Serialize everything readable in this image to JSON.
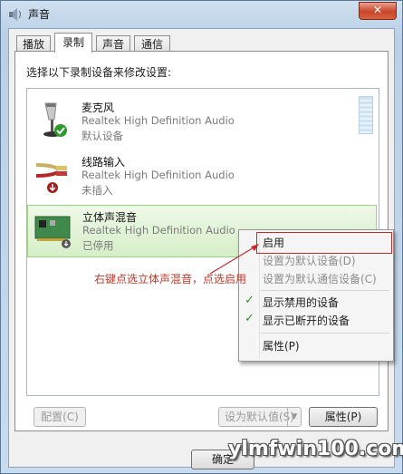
{
  "window": {
    "title": "声音",
    "close_label": "✕"
  },
  "tabs": [
    {
      "label": "播放",
      "active": false
    },
    {
      "label": "录制",
      "active": true
    },
    {
      "label": "声音",
      "active": false
    },
    {
      "label": "通信",
      "active": false
    }
  ],
  "instruction": "选择以下录制设备来修改设置:",
  "devices": [
    {
      "name": "麦克风",
      "driver": "Realtek High Definition Audio",
      "status": "默认设备",
      "icon": "microphone-icon"
    },
    {
      "name": "线路输入",
      "driver": "Realtek High Definition Audio",
      "status": "未插入",
      "icon": "line-in-icon"
    },
    {
      "name": "立体声混音",
      "driver": "Realtek High Definition Audio",
      "status": "已停用",
      "icon": "sound-card-icon"
    }
  ],
  "context_menu": {
    "items": [
      {
        "label": "启用",
        "disabled": false,
        "checked": false
      },
      {
        "label": "设置为默认设备(D)",
        "disabled": true,
        "checked": false
      },
      {
        "label": "设置为默认通信设备(C)",
        "disabled": true,
        "checked": false
      },
      {
        "label": "显示禁用的设备",
        "disabled": false,
        "checked": true
      },
      {
        "label": "显示已断开的设备",
        "disabled": false,
        "checked": true
      },
      {
        "label": "属性(P)",
        "disabled": false,
        "checked": false
      }
    ]
  },
  "annotation": "右键点选立体声混音，点选启用",
  "buttons": {
    "configure": "配置(C)",
    "set_default": "设为默认值(S)",
    "properties": "属性(P)",
    "ok": "确定"
  },
  "watermark": "ylmfwin100.com",
  "colors": {
    "accent_check": "#3a8a2a",
    "annotation_red": "#c62b2b",
    "selected_row": "#d6efc8"
  }
}
